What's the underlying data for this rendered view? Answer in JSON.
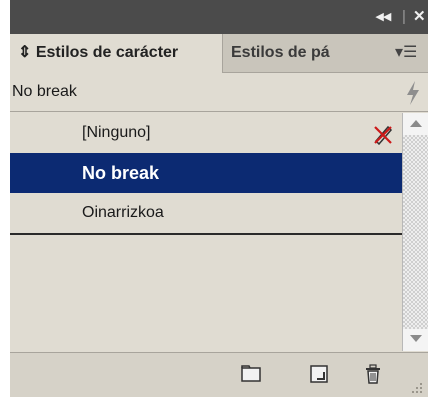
{
  "titlebar": {
    "collapse_label": "◂◂",
    "separator": "|",
    "close_label": "✕"
  },
  "tabs": [
    {
      "label": "Estilos de carácter",
      "prefix": "⇕"
    },
    {
      "label": "Estilos de pá"
    }
  ],
  "panel_menu_icon": "▾☰",
  "current_style": {
    "label": "No break"
  },
  "styles": [
    {
      "label": "[Ninguno]"
    },
    {
      "label": "No break"
    },
    {
      "label": "Oinarrizkoa"
    }
  ],
  "colors": {
    "selected_row": "#0c2a72",
    "panel_bg": "#e0dcd2",
    "titlebar_bg": "#4b4b4b"
  },
  "icons": {
    "lightning": "lightning-icon",
    "no_edit": "pencil-no-edit-icon",
    "folder": "new-folder-icon",
    "new_style": "new-style-icon",
    "delete": "trash-icon"
  }
}
